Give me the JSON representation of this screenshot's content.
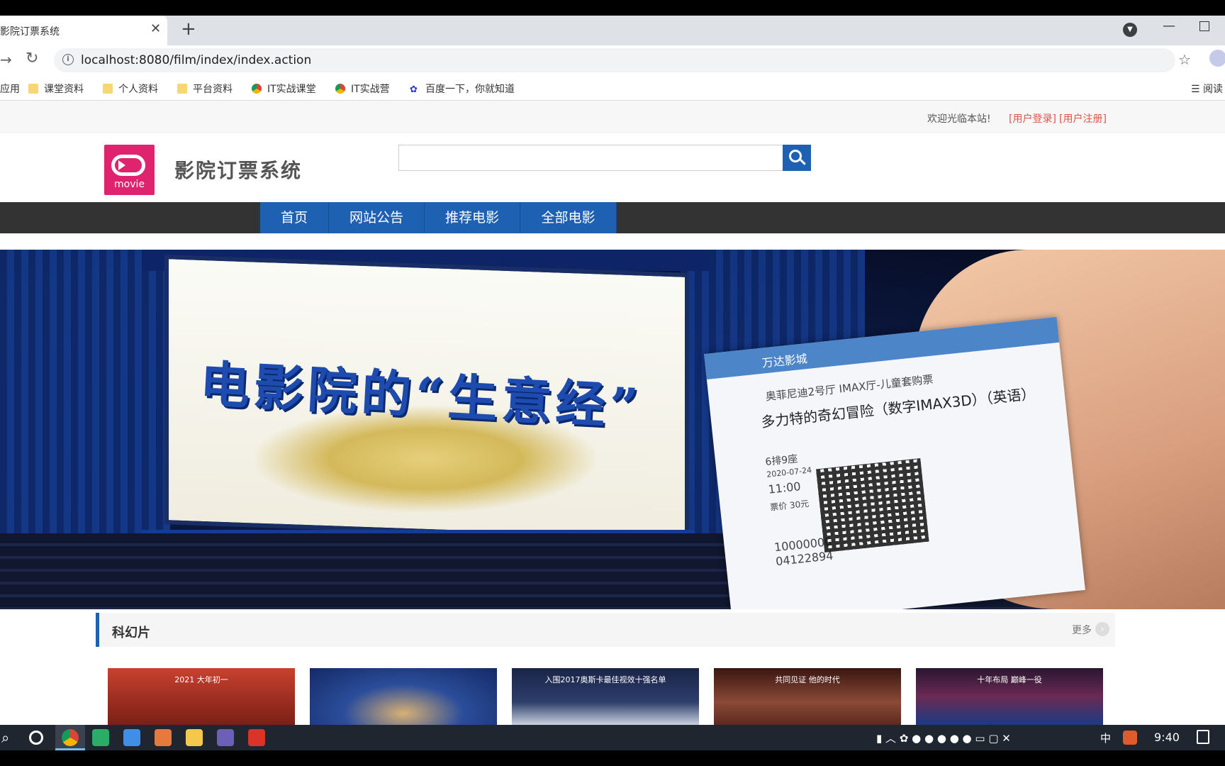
{
  "browser": {
    "tab_title": "影院订票系统",
    "tab_close": "✕",
    "new_tab": "+",
    "url": "localhost:8080/film/index/index.action",
    "star": "☆",
    "back_forward": "→",
    "reload": "↻"
  },
  "bookmarks": [
    {
      "label": "应用",
      "icon": "apps-icon"
    },
    {
      "label": "课堂资料",
      "icon": "folder-icon"
    },
    {
      "label": "个人资料",
      "icon": "folder-icon"
    },
    {
      "label": "平台资料",
      "icon": "folder-icon"
    },
    {
      "label": "IT实战课堂",
      "icon": "chrome-icon"
    },
    {
      "label": "IT实战营",
      "icon": "chrome-icon"
    },
    {
      "label": "百度一下，你就知道",
      "icon": "baidu-icon"
    }
  ],
  "reading_list": "阅读",
  "site": {
    "welcome": "欢迎光临本站!",
    "login_link": "[用户登录]",
    "register_link": "[用户注册]",
    "logo_text": "movie",
    "title": "影院订票系统",
    "search_placeholder": ""
  },
  "nav": [
    {
      "label": "首页"
    },
    {
      "label": "网站公告"
    },
    {
      "label": "推荐电影"
    },
    {
      "label": "全部电影"
    }
  ],
  "banner": {
    "headline": "电影院的“生意经”",
    "ticket_brand": "万达影城",
    "ticket_hall": "奥菲尼迪2号厅 IMAX厅-儿童套购票",
    "ticket_movie": "多力特的奇幻冒险（数字IMAX3D）（英语）",
    "ticket_seat": "6排9座",
    "ticket_date": "2020-07-24",
    "ticket_time": "11:00",
    "ticket_price": "票价 30元",
    "ticket_number": "10000000",
    "ticket_code": "04122894",
    "active_slide": 1,
    "slide_count": 4
  },
  "section": {
    "title": "科幻片",
    "more": "更多"
  },
  "posters": [
    {
      "caption": "2021 大年初一",
      "color": "#b5332a"
    },
    {
      "caption": "",
      "color": "#1d3a7a"
    },
    {
      "caption": "入围2017奥斯卡最佳视效十强名单",
      "color": "#1e2b52"
    },
    {
      "caption": "共同见证 他的时代",
      "color": "#5a2018"
    },
    {
      "caption": "十年布局 巅峰一役",
      "color": "#2a1a3a"
    }
  ],
  "taskbar": {
    "time": "9:40",
    "ime": "中"
  }
}
